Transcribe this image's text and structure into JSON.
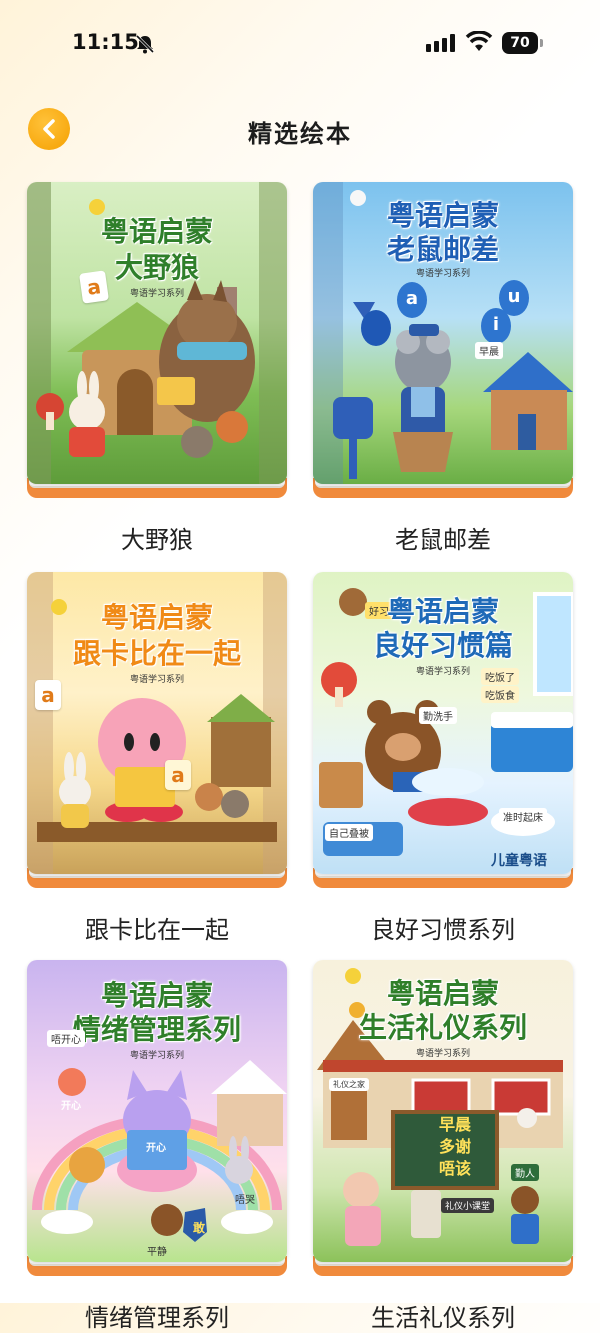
{
  "status_bar": {
    "time": "11:15",
    "battery": "70"
  },
  "header": {
    "title": "精选绘本"
  },
  "series_tag": "粤语学习系列",
  "books": [
    {
      "caption": "大野狼",
      "cover_line1": "粤语启蒙",
      "cover_line2": "大野狼",
      "letters": [
        "a"
      ]
    },
    {
      "caption": "老鼠邮差",
      "cover_line1": "粤语启蒙",
      "cover_line2": "老鼠邮差",
      "letters": [
        "a",
        "u",
        "i"
      ],
      "mail_label": "早晨"
    },
    {
      "caption": "跟卡比在一起",
      "cover_line1": "粤语启蒙",
      "cover_line2": "跟卡比在一起",
      "letters": [
        "a",
        "a"
      ]
    },
    {
      "caption": "良好习惯系列",
      "cover_line1": "粤语启蒙",
      "cover_line2": "良好习惯篇",
      "owl_label": "好习惯",
      "labels": [
        "勤洗手",
        "自己叠被",
        "准时起床",
        "吃饭了",
        "吃饭食"
      ],
      "brand": "儿童粤语"
    },
    {
      "caption": "情绪管理系列",
      "cover_line1": "粤语启蒙",
      "cover_line2": "情绪管理系列",
      "labels": [
        "开心",
        "唔开心",
        "唔哭",
        "平静"
      ],
      "book_label": "开心",
      "shield": "敢"
    },
    {
      "caption": "生活礼仪系列",
      "cover_line1": "粤语启蒙",
      "cover_line2": "生活礼仪系列",
      "board_lines": [
        "早晨",
        "多谢",
        "唔该"
      ],
      "house_label": "礼仪之家",
      "class_label": "礼仪小课堂",
      "tag": "勤人"
    }
  ]
}
